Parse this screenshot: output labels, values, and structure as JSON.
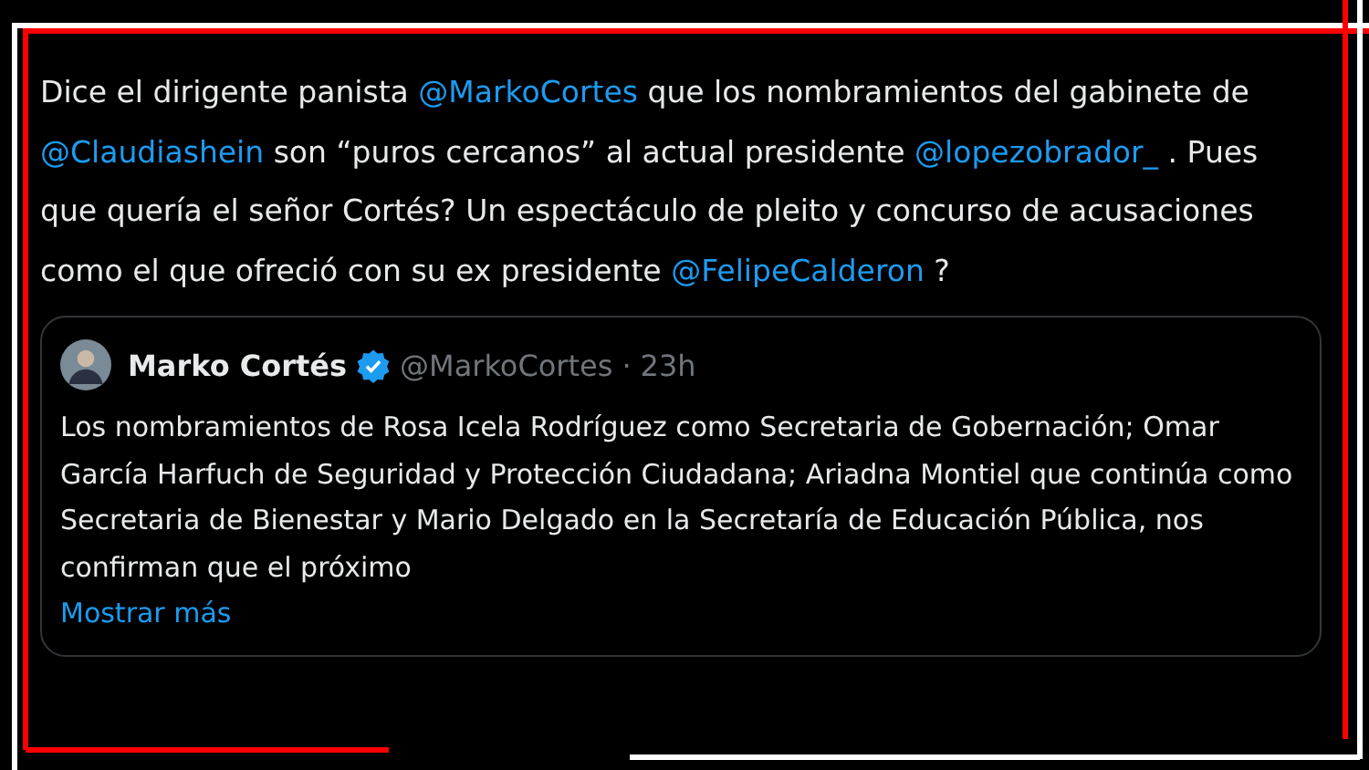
{
  "tweet": {
    "segments": [
      {
        "kind": "text",
        "text": "Dice el dirigente panista "
      },
      {
        "kind": "mention",
        "text": "@MarkoCortes"
      },
      {
        "kind": "text",
        "text": " que los nombramientos del gabinete de "
      },
      {
        "kind": "mention",
        "text": "@Claudiashein"
      },
      {
        "kind": "text",
        "text": " son “puros cercanos” al actual presidente "
      },
      {
        "kind": "mention",
        "text": "@lopezobrador_"
      },
      {
        "kind": "text",
        "text": " . Pues que quería el señor Cortés? Un espectáculo de pleito y concurso de acusaciones como el que ofreció con su ex presidente "
      },
      {
        "kind": "mention",
        "text": "@FelipeCalderon"
      },
      {
        "kind": "text",
        "text": " ?"
      }
    ]
  },
  "quote": {
    "name": "Marko Cortés",
    "verified": true,
    "handle": "@MarkoCortes",
    "separator": "·",
    "time": "23h",
    "text": "Los nombramientos de Rosa Icela Rodríguez como Secretaria de Gobernación; Omar García Harfuch de Seguridad y Protección Ciudadana; Ariadna Montiel que continúa como Secretaria de Bienestar y Mario Delgado en la Secretaría de Educación Pública, nos confirman que el próximo",
    "more": "Mostrar más"
  }
}
